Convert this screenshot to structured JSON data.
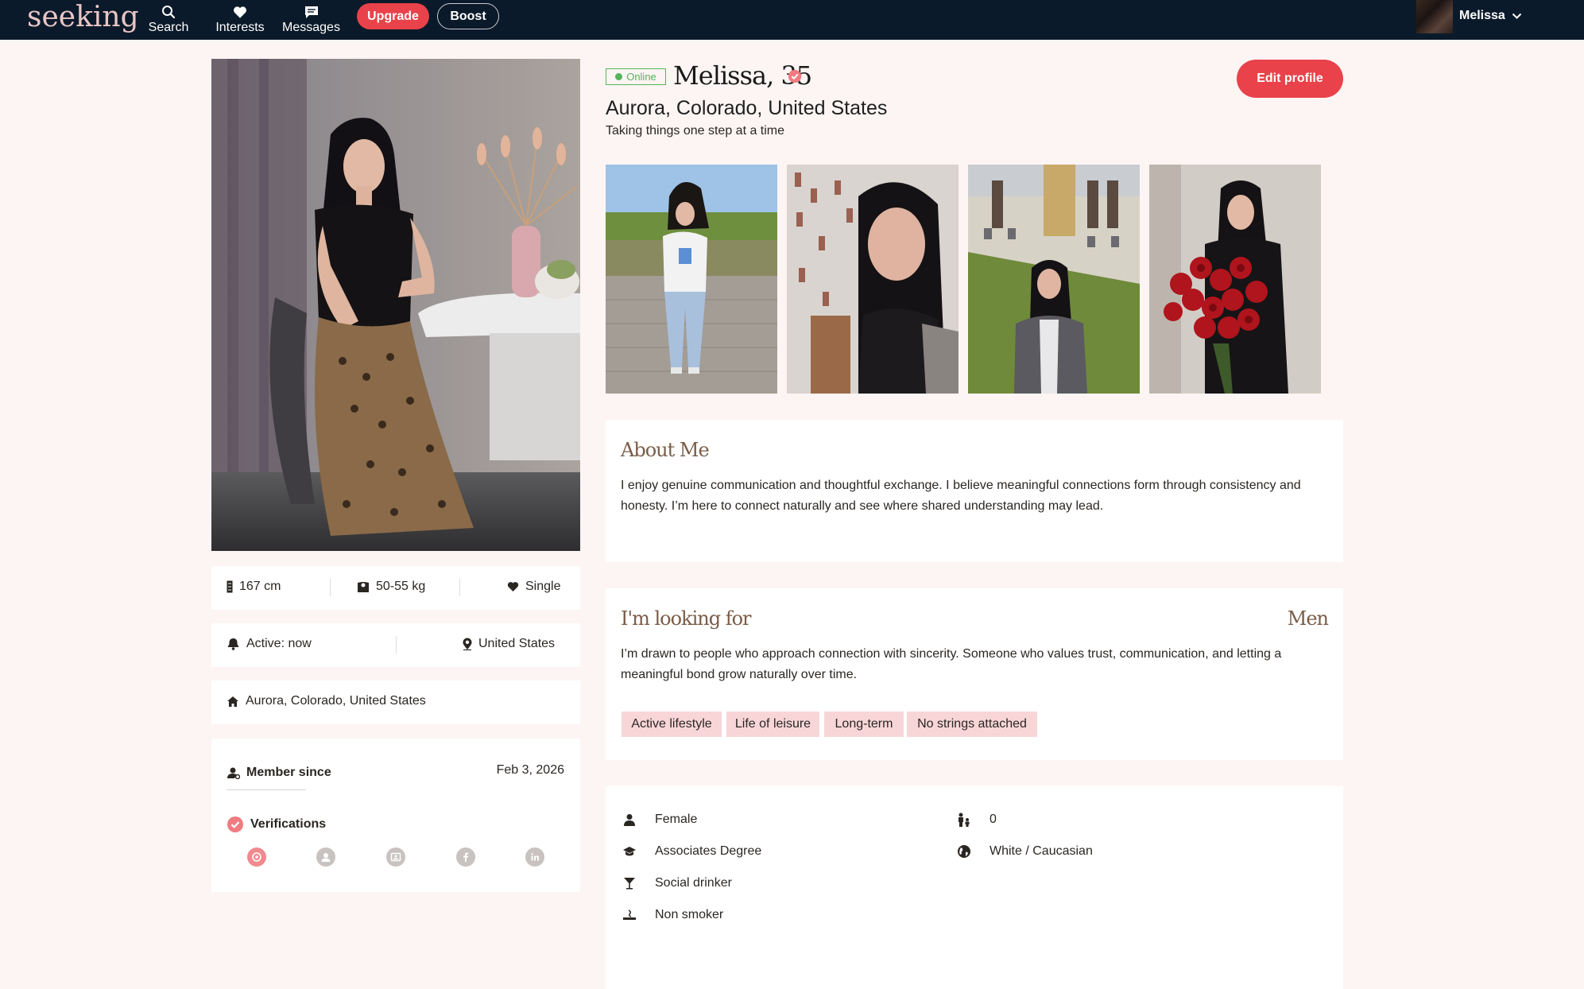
{
  "header": {
    "logo": "seeking",
    "nav": [
      {
        "label": "Search",
        "icon": "search-icon"
      },
      {
        "label": "Interests",
        "icon": "heart-icon"
      },
      {
        "label": "Messages",
        "icon": "message-icon"
      }
    ],
    "upgrade_label": "Upgrade",
    "boost_label": "Boost",
    "user_name": "Melissa"
  },
  "profile": {
    "status": "Online",
    "name_age": "Melissa, 35",
    "location": "Aurora, Colorado, United States",
    "tagline": "Taking things one step at a time",
    "edit_label": "Edit profile"
  },
  "stats": {
    "height": "167 cm",
    "weight": "50-55 kg",
    "relationship": "Single",
    "active": "Active: now",
    "country": "United States",
    "home": "Aurora, Colorado, United States",
    "member_since_label": "Member since",
    "member_since_value": "Feb 3, 2026",
    "verifications_label": "Verifications"
  },
  "about": {
    "title": "About Me",
    "text": "I enjoy genuine communication and thoughtful exchange. I believe meaningful connections form through consistency and honesty. I’m here to connect naturally and see where shared understanding may lead."
  },
  "looking_for": {
    "title": "I'm looking for",
    "target": "Men",
    "text": "I’m drawn to people who approach connection with sincerity. Someone who values trust, communication, and letting a meaningful bond grow naturally over time.",
    "tags": [
      "Active lifestyle",
      "Life of leisure",
      "Long-term",
      "No strings attached"
    ]
  },
  "details": {
    "gender": "Female",
    "education": "Associates Degree",
    "drinking": "Social drinker",
    "smoking": "Non smoker",
    "children": "0",
    "ethnicity": "White / Caucasian"
  },
  "colors": {
    "nav_bg": "#0b1a2a",
    "accent": "#e9424a",
    "online": "#58b35a",
    "page_bg": "#fcf5f4",
    "tag_bg": "#f8d6d8",
    "heading": "#7a5c48"
  }
}
